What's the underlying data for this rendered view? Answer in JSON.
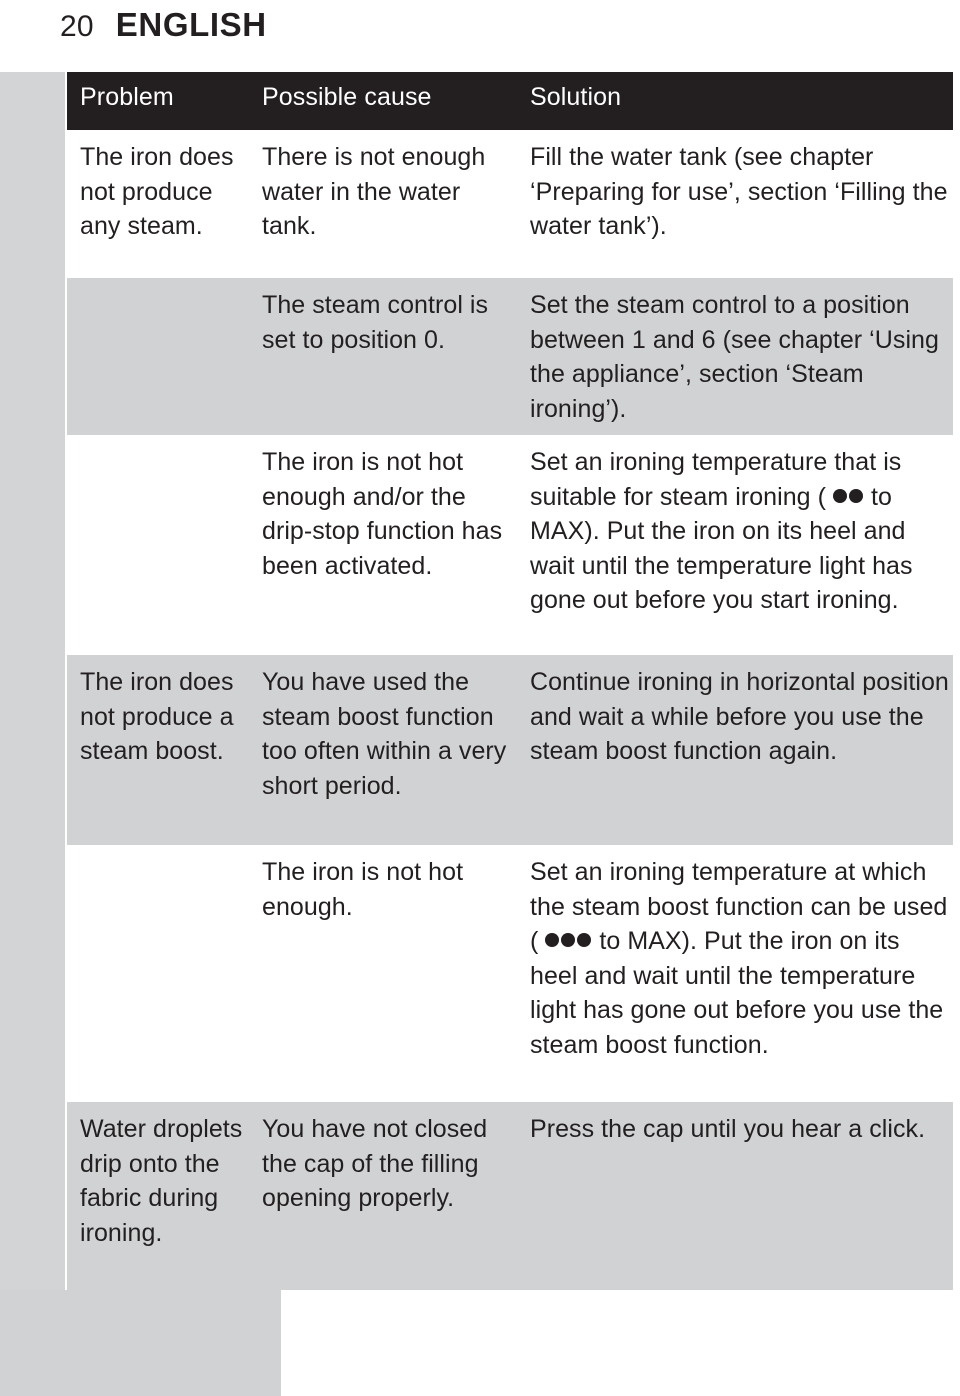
{
  "page": {
    "number": "20",
    "title": "ENGLISH"
  },
  "colors": {
    "header_background": "#231f20",
    "header_text": "#ffffff",
    "row_gray": "#d0d2d4",
    "row_white": "#ffffff",
    "margin_strip": "#d2d4d6",
    "body_text": "#231f20"
  },
  "table": {
    "columns": [
      {
        "key": "problem",
        "label": "Problem"
      },
      {
        "key": "cause",
        "label": "Possible cause"
      },
      {
        "key": "solution",
        "label": "Solution"
      }
    ],
    "rows": [
      {
        "shade": "white",
        "problem": "The iron does not produce any steam.",
        "cause": "There is not enough water in the water tank.",
        "solution": "Fill the water tank (see chapter ‘Preparing for use’, section ‘Filling the water tank’)."
      },
      {
        "shade": "gray",
        "problem": "",
        "cause": "The steam control is set to position 0.",
        "solution": "Set the steam control to a position between 1 and 6 (see chapter ‘Using the appliance’, section ‘Steam ironing’)."
      },
      {
        "shade": "white",
        "problem": "",
        "cause": "The iron is not hot enough and/or the drip-stop function has been activated.",
        "solution_parts": {
          "before_dots": "Set an ironing temperature that is suitable for steam ironing (",
          "dot_count": 2,
          "after_dots": " to MAX). Put the iron on its heel and wait until the temperature light has gone out before you start ironing."
        }
      },
      {
        "shade": "gray",
        "problem": "The iron does not produce a steam boost.",
        "cause": "You have used the steam boost function too often within a very short period.",
        "solution": "Continue ironing in horizontal position and wait a while before you use the steam boost function again."
      },
      {
        "shade": "white",
        "problem": "",
        "cause": "The iron is not hot enough.",
        "solution_parts": {
          "before_dots": "Set an ironing temperature at which the steam boost function can be used (",
          "dot_count": 3,
          "after_dots": " to MAX). Put the iron on its heel and wait until the temperature light has gone out before you use the steam boost function."
        }
      },
      {
        "shade": "gray",
        "problem": "Water droplets drip onto the fabric during ironing.",
        "cause": "You have not closed the cap of the filling opening properly.",
        "solution": "Press the cap until you hear a click."
      }
    ]
  }
}
